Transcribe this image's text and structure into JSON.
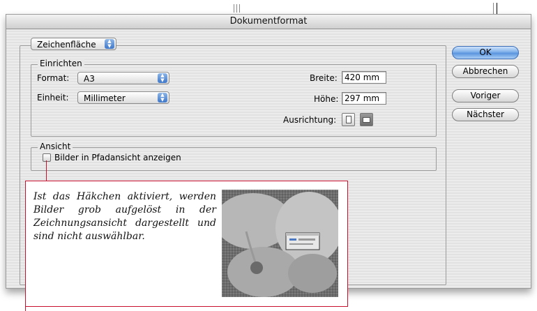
{
  "dialog": {
    "title": "Dokumentformat",
    "top_popup": "Zeichenfläche",
    "einrichten": {
      "legend": "Einrichten",
      "format_label": "Format:",
      "format_value": "A3",
      "unit_label": "Einheit:",
      "unit_value": "Millimeter",
      "width_label": "Breite:",
      "width_value": "420 mm",
      "height_label": "Höhe:",
      "height_value": "297 mm",
      "orientation_label": "Ausrichtung:",
      "orientation_selected": "landscape"
    },
    "ansicht": {
      "legend": "Ansicht",
      "checkbox_label": "Bilder in Pfadansicht anzeigen",
      "checked": false
    },
    "buttons": {
      "ok": "OK",
      "cancel": "Abbrechen",
      "prev": "Voriger",
      "next": "Nächster"
    }
  },
  "callout": {
    "text": "Ist das Häkchen aktiviert, werden Bilder grob aufgelöst in der Zeichnungsansicht dargestellt und sind nicht auswählbar.",
    "accent_color": "#c8102e",
    "image": "hibiscus-flower-grayscale"
  }
}
